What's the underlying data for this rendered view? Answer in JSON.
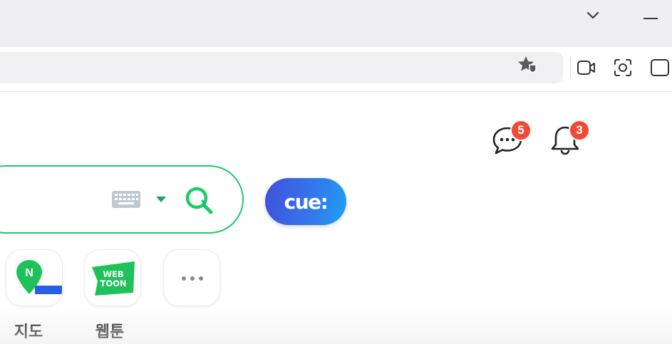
{
  "browser": {
    "tab_menu_icon": "chevron-down-icon",
    "minimize_icon": "minimize-icon",
    "address_bar_value": "",
    "toolbar_icons": [
      "bookmark-star-icon",
      "video-capture-icon",
      "screenshot-icon",
      "sidebar-icon"
    ]
  },
  "header": {
    "chat_badge": "5",
    "notifications_badge": "3",
    "badge_color": "#f04a35"
  },
  "search": {
    "query": "",
    "border_color": "#24c76b",
    "keyboard_icon": "keyboard-icon",
    "dropdown_icon": "triangle-down-icon",
    "search_icon": "search-icon"
  },
  "cue": {
    "label": "cue:"
  },
  "shortcuts": [
    {
      "label": "지도",
      "icon": "naver-map-icon",
      "icon_text": "N"
    },
    {
      "label": "웹툰",
      "icon": "webtoon-icon",
      "icon_text_1": "WEB",
      "icon_text_2": "TOON"
    },
    {
      "label": "",
      "icon": "more-icon"
    }
  ]
}
